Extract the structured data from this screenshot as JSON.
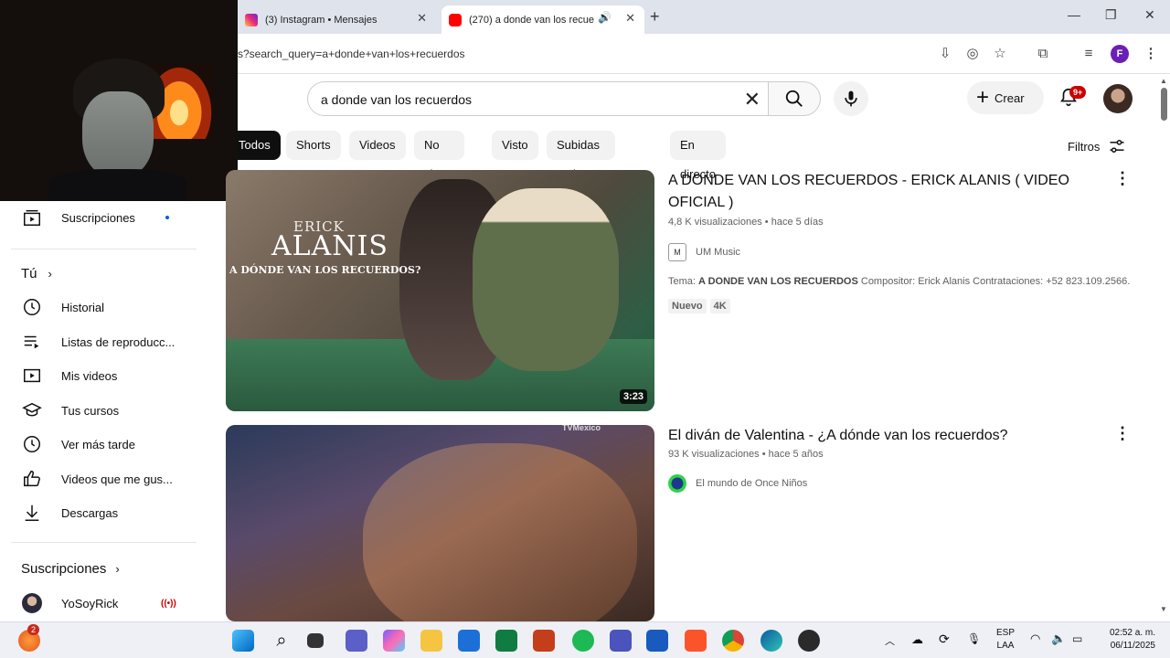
{
  "browser": {
    "tabs": [
      {
        "title": "(3) Instagram • Mensajes",
        "active": false
      },
      {
        "title": "(270) a donde van los recue",
        "active": true
      }
    ],
    "url": "s?search_query=a+donde+van+los+recuerdos"
  },
  "header": {
    "search_value": "a donde van los recuerdos",
    "create_label": "Crear",
    "notifications_badge": "9+"
  },
  "chips": [
    "Todos",
    "Shorts",
    "Videos",
    "No vistos",
    "Visto",
    "Subidas recientes",
    "En directo"
  ],
  "filters_label": "Filtros",
  "sidebar": {
    "subscriptions_item": "Suscripciones",
    "you_heading": "Tú",
    "items": [
      "Historial",
      "Listas de reproducc...",
      "Mis videos",
      "Tus cursos",
      "Ver más tarde",
      "Videos que me gus...",
      "Descargas"
    ],
    "subs_heading": "Suscripciones",
    "channel": "YoSoyRick"
  },
  "videos": [
    {
      "title": "A DONDE VAN LOS RECUERDOS - ERICK ALANIS ( VIDEO OFICIAL )",
      "views": "4,8 K visualizaciones",
      "age": "hace 5 días",
      "channel": "UM Music",
      "desc_prefix": "Tema: ",
      "desc_bold": "A DONDE VAN LOS RECUERDOS",
      "desc_rest": " Compositor: Erick Alanis Contrataciones: +52 823.109.2566.",
      "badges": [
        "Nuevo",
        "4K"
      ],
      "duration": "3:23",
      "thumb_brand": "ERICK",
      "thumb_name": "ALANIS",
      "thumb_subtitle": "A DÓNDE VAN LOS RECUERDOS?"
    },
    {
      "title": "El diván de Valentina - ¿A dónde van los recuerdos?",
      "views": "93 K visualizaciones",
      "age": "hace 5 años",
      "channel": "El mundo de Once Niños",
      "thumb_watermark": "TVMexico"
    }
  ],
  "taskbar": {
    "start_badge": "2",
    "lang_top": "ESP",
    "lang_bottom": "LAA",
    "time": "02:52 a. m.",
    "date": "06/11/2025"
  },
  "colors": {
    "youtube_red": "#ff0000",
    "chip_active": "#0f0f0f",
    "badge_red": "#cc0000"
  }
}
